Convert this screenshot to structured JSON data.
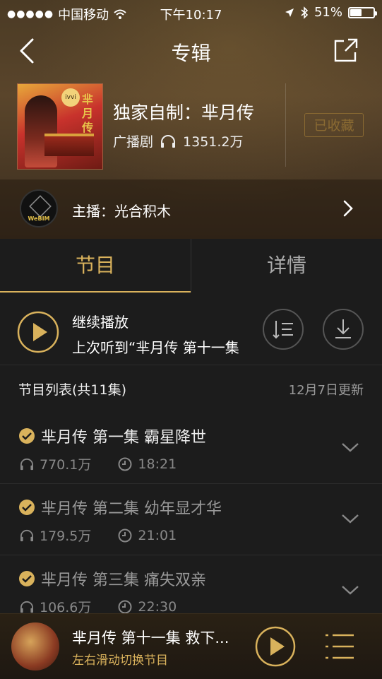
{
  "status_bar": {
    "carrier": "中国移动",
    "time": "下午10:17",
    "battery_percent": "51%",
    "battery_level": 0.51
  },
  "nav": {
    "title": "专辑"
  },
  "album": {
    "name": "独家自制：芈月传",
    "category": "广播剧",
    "plays": "1351.2万",
    "collect_label": "已收藏",
    "cover_seal_text": "芈月传",
    "cover_badge_text": "ivvi"
  },
  "host": {
    "label": "主播：光合积木",
    "avatar_text": "WeBIM"
  },
  "tabs": [
    {
      "label": "节目"
    },
    {
      "label": "详情"
    }
  ],
  "continue": {
    "title": "继续播放",
    "last": "上次听到“芈月传 第十一集"
  },
  "list_header": {
    "title": "节目列表(共11集)",
    "updated": "12月7日更新"
  },
  "episodes": [
    {
      "title": "芈月传 第一集 霸星降世",
      "plays": "770.1万",
      "duration": "18:21"
    },
    {
      "title": "芈月传 第二集 幼年显才华",
      "plays": "179.5万",
      "duration": "21:01"
    },
    {
      "title": "芈月传 第三集 痛失双亲",
      "plays": "106.6万",
      "duration": "22:30"
    }
  ],
  "player": {
    "now_playing": "芈月传 第十一集 救下...",
    "hint": "左右滑动切换节目"
  },
  "colors": {
    "accent": "#d9b25c",
    "collect_border": "#8a6a32"
  }
}
